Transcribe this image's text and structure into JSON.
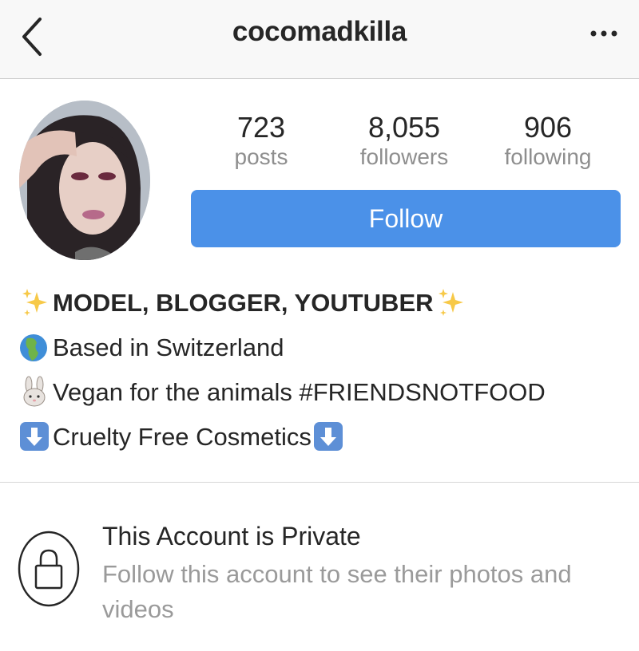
{
  "header": {
    "back_icon": "chevron-left-icon",
    "title": "cocomadkilla",
    "more_icon": "more-horizontal-icon"
  },
  "stats": {
    "posts": {
      "value": "723",
      "label": "posts"
    },
    "followers": {
      "value": "8,055",
      "label": "followers"
    },
    "following": {
      "value": "906",
      "label": "following"
    }
  },
  "follow_button": {
    "label": "Follow",
    "color": "#4b91e8"
  },
  "bio": [
    {
      "text": "MODEL, BLOGGER, YOUTUBER",
      "leading_icon": "sparkles-icon",
      "trailing_icon": "sparkles-icon"
    },
    {
      "text": "Based in Switzerland",
      "leading_icon": "globe-icon"
    },
    {
      "text": "Vegan for the animals #FRIENDSNOTFOOD",
      "leading_icon": "rabbit-icon"
    },
    {
      "text": "Cruelty Free Cosmetics",
      "leading_icon": "down-arrow-icon",
      "trailing_icon": "down-arrow-icon"
    }
  ],
  "private": {
    "icon": "lock-icon",
    "title": "This Account is Private",
    "subtitle": "Follow this account to see their photos and videos"
  },
  "colors": {
    "accent": "#4b91e8",
    "muted_text": "#8e8e8e",
    "header_bg": "#f8f8f8"
  }
}
